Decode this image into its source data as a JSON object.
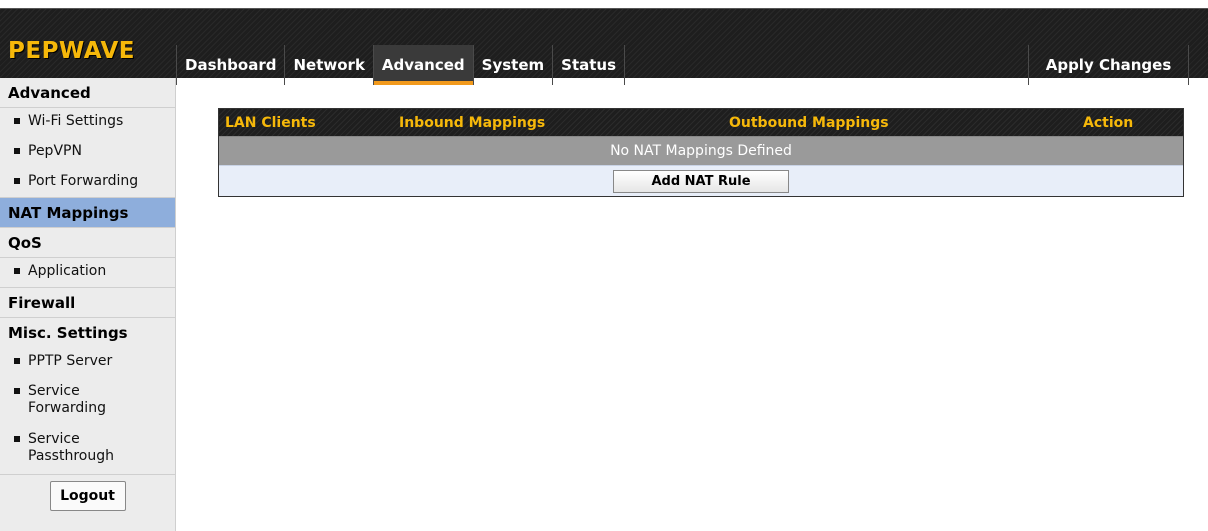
{
  "brand": {
    "logo_text": "PEPWAVE",
    "accent_color": "#f6b80a"
  },
  "nav": {
    "items": [
      {
        "label": "Dashboard"
      },
      {
        "label": "Network"
      },
      {
        "label": "Advanced",
        "active": true
      },
      {
        "label": "System"
      },
      {
        "label": "Status"
      }
    ],
    "apply_label": "Apply Changes",
    "active_underline_color": "#f29a1c"
  },
  "sidebar": {
    "sections": [
      {
        "title": "Advanced",
        "items": [
          "Wi-Fi Settings",
          "PepVPN",
          "Port Forwarding"
        ]
      },
      {
        "title": "NAT Mappings",
        "selected": true,
        "items": []
      },
      {
        "title": "QoS",
        "items": [
          "Application"
        ]
      },
      {
        "title": "Firewall",
        "items": []
      },
      {
        "title": "Misc. Settings",
        "items": [
          "PPTP Server",
          "Service Forwarding",
          "Service Passthrough"
        ]
      }
    ],
    "logout_label": "Logout",
    "selected_color": "#8eaedc"
  },
  "nat_table": {
    "columns": [
      "LAN Clients",
      "Inbound Mappings",
      "Outbound Mappings",
      "Action"
    ],
    "empty_message": "No NAT Mappings Defined",
    "add_button_label": "Add NAT Rule"
  }
}
